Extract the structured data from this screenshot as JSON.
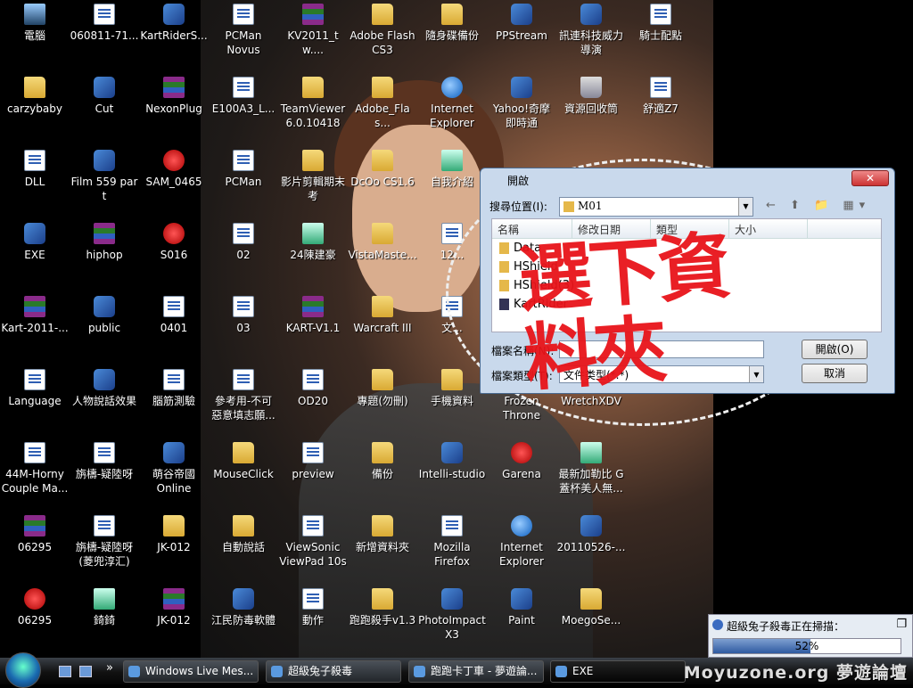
{
  "desktop": {
    "columns": [
      [
        {
          "label": "電腦",
          "type": "pc"
        },
        {
          "label": "carzybaby",
          "type": "folder"
        },
        {
          "label": "DLL",
          "type": "doc"
        },
        {
          "label": "EXE",
          "type": "app"
        },
        {
          "label": "Kart-2011-...",
          "type": "rar"
        },
        {
          "label": "Language",
          "type": "doc"
        },
        {
          "label": "44M-Horny\nCouple Ma...",
          "type": "doc"
        },
        {
          "label": "06295",
          "type": "rar"
        },
        {
          "label": "06295",
          "type": "red"
        }
      ],
      [
        {
          "label": "060811-71...",
          "type": "doc"
        },
        {
          "label": "Cut",
          "type": "app"
        },
        {
          "label": "Film 559 part",
          "type": "app"
        },
        {
          "label": "hiphop",
          "type": "rar"
        },
        {
          "label": "public",
          "type": "app"
        },
        {
          "label": "人物說話效果",
          "type": "app"
        },
        {
          "label": "旃檮-疑陸呀",
          "type": "doc"
        },
        {
          "label": "旃檮-疑陸呀\n(菱兜淳汇)",
          "type": "doc"
        },
        {
          "label": "錡錡",
          "type": "mpg"
        }
      ],
      [
        {
          "label": "KartRiderS...",
          "type": "app"
        },
        {
          "label": "NexonPlug",
          "type": "rar"
        },
        {
          "label": "SAM_0465",
          "type": "red"
        },
        {
          "label": "S016",
          "type": "red"
        },
        {
          "label": "0401",
          "type": "doc"
        },
        {
          "label": "腦筋測驗",
          "type": "doc"
        },
        {
          "label": "萌谷帝國\nOnline",
          "type": "app"
        },
        {
          "label": "JK-012",
          "type": "folder"
        },
        {
          "label": "JK-012",
          "type": "rar"
        }
      ],
      [
        {
          "label": "PCMan\nNovus",
          "type": "doc"
        },
        {
          "label": "E100A3_L...",
          "type": "doc"
        },
        {
          "label": "PCMan",
          "type": "doc"
        },
        {
          "label": "02",
          "type": "doc"
        },
        {
          "label": "03",
          "type": "doc"
        },
        {
          "label": "參考用-不可\n惡意填志願...",
          "type": "doc"
        },
        {
          "label": "MouseClick",
          "type": "folder"
        },
        {
          "label": "自動說話",
          "type": "folder"
        },
        {
          "label": "江民防毒軟體",
          "type": "app"
        }
      ],
      [
        {
          "label": "KV2011_tw....",
          "type": "rar"
        },
        {
          "label": "TeamViewer\n6.0.10418",
          "type": "folder"
        },
        {
          "label": "影片剪輯期末\n考",
          "type": "folder"
        },
        {
          "label": "24陳建豪",
          "type": "mpg"
        },
        {
          "label": "KART-V1.1",
          "type": "rar"
        },
        {
          "label": "OD20",
          "type": "doc"
        },
        {
          "label": "preview",
          "type": "doc"
        },
        {
          "label": "ViewSonic\nViewPad 10s",
          "type": "doc"
        },
        {
          "label": "動作",
          "type": "doc"
        }
      ],
      [
        {
          "label": "Adobe Flash\nCS3",
          "type": "folder"
        },
        {
          "label": "Adobe_Flas...",
          "type": "folder"
        },
        {
          "label": "DcOo CS1.6",
          "type": "folder"
        },
        {
          "label": "VistaMaste...",
          "type": "folder"
        },
        {
          "label": "Warcraft III",
          "type": "folder"
        },
        {
          "label": "專題(勿刪)",
          "type": "folder"
        },
        {
          "label": "備份",
          "type": "folder"
        },
        {
          "label": "新增資料夾",
          "type": "folder"
        },
        {
          "label": "跑跑殺手v1.3",
          "type": "folder"
        }
      ],
      [
        {
          "label": "隨身碟備份",
          "type": "folder"
        },
        {
          "label": "Internet\nExplorer",
          "type": "ie"
        },
        {
          "label": "自我介紹",
          "type": "mpg"
        },
        {
          "label": "12...",
          "type": "doc"
        },
        {
          "label": "文...",
          "type": "doc"
        },
        {
          "label": "手機資料",
          "type": "folder"
        },
        {
          "label": "Intelli-studio",
          "type": "app"
        },
        {
          "label": "Mozilla\nFirefox",
          "type": "doc"
        },
        {
          "label": "PhotoImpact\nX3",
          "type": "app"
        }
      ],
      [
        {
          "label": "PPStream",
          "type": "app"
        },
        {
          "label": "Yahoo!奇摩\n即時通",
          "type": "app"
        },
        null,
        null,
        null,
        {
          "label": "Frozen\nThrone",
          "type": "none"
        },
        {
          "label": "Garena",
          "type": "red"
        },
        {
          "label": "Internet\nExplorer",
          "type": "ie"
        },
        {
          "label": "Paint",
          "type": "app"
        }
      ],
      [
        {
          "label": "訊連科技威力\n導演",
          "type": "app"
        },
        {
          "label": "資源回收筒",
          "type": "bin"
        },
        null,
        null,
        null,
        {
          "label": "WretchXDV",
          "type": "none"
        },
        {
          "label": "最新加勒比 G\n蓋杯美人無...",
          "type": "mpg"
        },
        {
          "label": "20110526-...",
          "type": "app"
        },
        {
          "label": "MoegoSe...",
          "type": "folder"
        }
      ],
      [
        {
          "label": "騎士配點",
          "type": "doc"
        },
        {
          "label": "舒適Z7",
          "type": "doc"
        }
      ]
    ]
  },
  "dialog": {
    "title": "開啟",
    "close": "✕",
    "look_in_label": "搜尋位置(I):",
    "look_in_value": "M01",
    "tools": "← ⬆ 📁 ▦▾",
    "columns": [
      "名稱",
      "修改日期",
      "類型",
      "大小"
    ],
    "files": [
      "Data",
      "HShield",
      "HShield(3)",
      "KartRider"
    ],
    "filename_label": "檔案名稱(N):",
    "filename_value": "",
    "filetype_label": "檔案類型(T):",
    "filetype_value": "文件类型(*.*)",
    "open_button": "開啟(O)",
    "cancel_button": "取消"
  },
  "annotation": "選下資料夾",
  "scanner": {
    "title": "超級兔子殺毒正在掃描：",
    "progress_percent": 52,
    "progress_label": "52%",
    "restore": "❐"
  },
  "taskbar": {
    "chevron": "»",
    "buttons": [
      "Windows Live Mes...",
      "超級兔子殺毒",
      "跑跑卡丁車 - 夢遊論...",
      "EXE"
    ],
    "watermark": "Moyuzone.org 夢遊論壇"
  }
}
